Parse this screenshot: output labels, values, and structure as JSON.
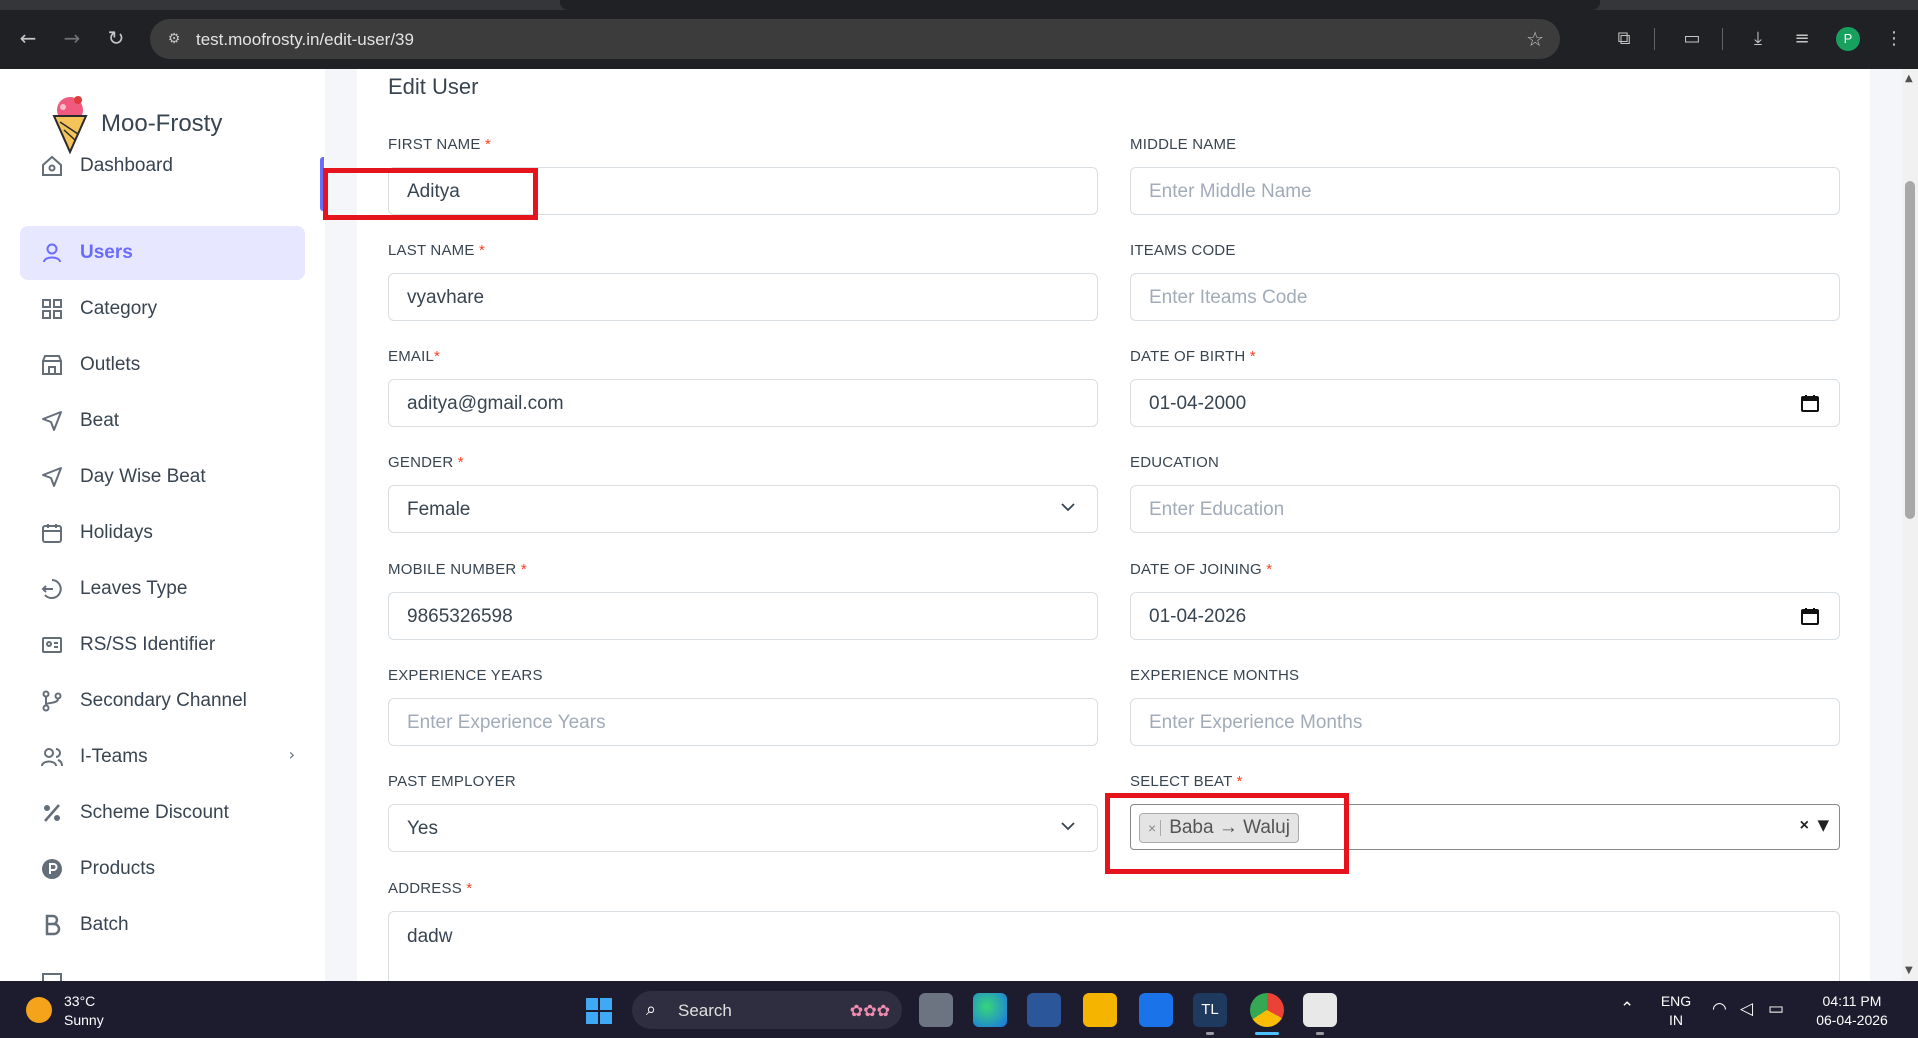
{
  "browser": {
    "url": "test.moofrosty.in/edit-user/39",
    "profile_initial": "P"
  },
  "sidebar": {
    "brand": "Moo-Frosty",
    "items": [
      {
        "label": "Dashboard",
        "icon": "home-icon"
      },
      {
        "label": "Users",
        "icon": "user-icon",
        "active": true
      },
      {
        "label": "Category",
        "icon": "grid-icon"
      },
      {
        "label": "Outlets",
        "icon": "store-icon"
      },
      {
        "label": "Beat",
        "icon": "send-icon"
      },
      {
        "label": "Day Wise Beat",
        "icon": "send-icon"
      },
      {
        "label": "Holidays",
        "icon": "calendar-icon"
      },
      {
        "label": "Leaves Type",
        "icon": "logout-circle-icon"
      },
      {
        "label": "RS/SS Identifier",
        "icon": "id-card-icon"
      },
      {
        "label": "Secondary Channel",
        "icon": "git-branch-icon"
      },
      {
        "label": "I-Teams",
        "icon": "users-icon",
        "has_submenu": true
      },
      {
        "label": "Scheme Discount",
        "icon": "percent-icon"
      },
      {
        "label": "Products",
        "icon": "p-circle-icon"
      },
      {
        "label": "Batch",
        "icon": "b-letter-icon"
      }
    ]
  },
  "form": {
    "title": "Edit User",
    "first_name": {
      "label": "FIRST NAME",
      "required": "*",
      "value": "Aditya"
    },
    "middle_name": {
      "label": "MIDDLE NAME",
      "placeholder": "Enter Middle Name"
    },
    "last_name": {
      "label": "LAST NAME",
      "required": "*",
      "value": "vyavhare"
    },
    "iteams_code": {
      "label": "ITEAMS CODE",
      "placeholder": "Enter Iteams Code"
    },
    "email": {
      "label": "EMAIL",
      "required": "*",
      "value": "aditya@gmail.com"
    },
    "dob": {
      "label": "DATE OF BIRTH",
      "required": "*",
      "value": "01-04-2000"
    },
    "gender": {
      "label": "GENDER",
      "required": "*",
      "value": "Female"
    },
    "education": {
      "label": "EDUCATION",
      "placeholder": "Enter Education"
    },
    "mobile": {
      "label": "MOBILE NUMBER",
      "required": "*",
      "value": "9865326598"
    },
    "doj": {
      "label": "DATE OF JOINING",
      "required": "*",
      "value": "01-04-2026"
    },
    "exp_years": {
      "label": "EXPERIENCE YEARS",
      "placeholder": "Enter Experience Years"
    },
    "exp_months": {
      "label": "EXPERIENCE MONTHS",
      "placeholder": "Enter Experience Months"
    },
    "past_employer": {
      "label": "PAST EMPLOYER",
      "value": "Yes"
    },
    "select_beat": {
      "label": "SELECT BEAT",
      "required": "*",
      "chips": [
        "Baba → Waluj"
      ],
      "chip_remove": "×",
      "clear": "×",
      "arrow": "▼"
    },
    "address": {
      "label": "ADDRESS",
      "required": "*",
      "value": "dadw"
    }
  },
  "taskbar": {
    "weather_temp": "33°C",
    "weather_desc": "Sunny",
    "search_label": "Search",
    "lang_top": "ENG",
    "lang_bottom": "IN",
    "time": "04:11 PM",
    "date": "06-04-2026"
  },
  "colors": {
    "accent": "#696cff",
    "required": "#ff3e1d",
    "highlight": "#e5131c"
  }
}
